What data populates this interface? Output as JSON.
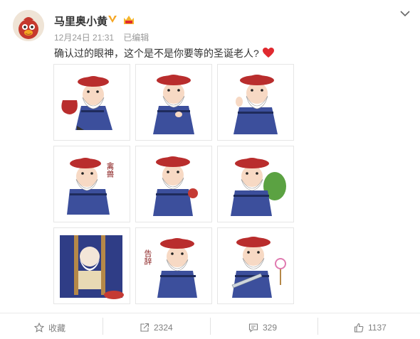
{
  "post": {
    "author": "马里奥小黄",
    "time": "12月24日 21:31",
    "edited": "已编辑",
    "text": "确认过的眼神，这个是不是你要等的圣诞老人?",
    "sticker_captions": [
      "禽兽",
      "告辞"
    ]
  },
  "actions": {
    "favorite_label": "收藏",
    "repost_count": "2324",
    "comment_count": "329",
    "like_count": "1137"
  },
  "colors": {
    "verified": "#f5a623",
    "heart": "#e0292f",
    "hat": "#b92d2d",
    "robe": "#3c4f9c"
  }
}
